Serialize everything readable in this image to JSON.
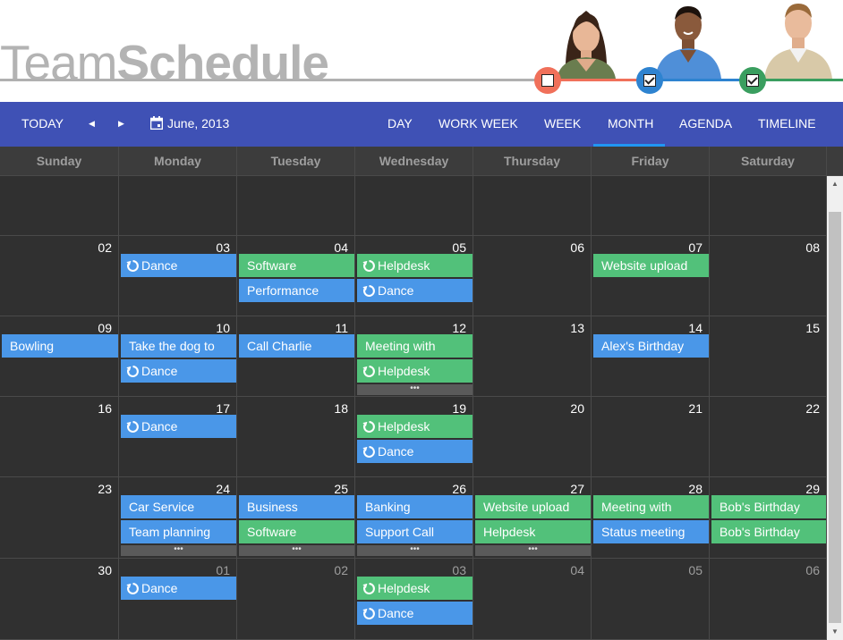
{
  "app": {
    "title_light": "Team",
    "title_bold": "Schedule"
  },
  "employees": [
    {
      "color": "#f0705a",
      "checked": false,
      "photo": "woman-portrait"
    },
    {
      "color": "#2e83d0",
      "checked": true,
      "photo": "man-portrait"
    },
    {
      "color": "#3a9e5f",
      "checked": true,
      "photo": "man-portrait"
    }
  ],
  "toolbar": {
    "today": "TODAY",
    "prev_icon": "caret-left-icon",
    "next_icon": "caret-right-icon",
    "calendar_icon": "calendar-icon",
    "date_label": "June, 2013",
    "views": [
      "DAY",
      "WORK WEEK",
      "WEEK",
      "MONTH",
      "AGENDA",
      "TIMELINE"
    ],
    "active_view": "MONTH"
  },
  "colors": {
    "toolbar": "#3f51b5",
    "active_underline": "#2196f3",
    "event_blue": "#4a97e8",
    "event_green": "#52c17a",
    "grid_bg": "#303030"
  },
  "day_headers": [
    "Sunday",
    "Monday",
    "Tuesday",
    "Wednesday",
    "Thursday",
    "Friday",
    "Saturday"
  ],
  "weeks": [
    {
      "days": [
        {
          "date": "",
          "events": []
        },
        {
          "date": "",
          "events": []
        },
        {
          "date": "",
          "events": []
        },
        {
          "date": "",
          "events": []
        },
        {
          "date": "",
          "events": []
        },
        {
          "date": "",
          "events": []
        },
        {
          "date": "",
          "events": []
        }
      ]
    },
    {
      "days": [
        {
          "date": "02",
          "events": []
        },
        {
          "date": "03",
          "events": [
            {
              "text": "Dance",
              "color": "blue",
              "recurring": true
            }
          ]
        },
        {
          "date": "04",
          "events": [
            {
              "text": "Software",
              "color": "green",
              "recurring": false
            },
            {
              "text": "Performance",
              "color": "blue",
              "recurring": false
            }
          ]
        },
        {
          "date": "05",
          "events": [
            {
              "text": "Helpdesk",
              "color": "green",
              "recurring": true
            },
            {
              "text": "Dance",
              "color": "blue",
              "recurring": true
            }
          ]
        },
        {
          "date": "06",
          "events": []
        },
        {
          "date": "07",
          "events": [
            {
              "text": "Website upload",
              "color": "green",
              "recurring": false
            }
          ]
        },
        {
          "date": "08",
          "events": []
        }
      ]
    },
    {
      "days": [
        {
          "date": "09",
          "events": [
            {
              "text": "Bowling",
              "color": "blue",
              "recurring": false
            }
          ]
        },
        {
          "date": "10",
          "events": [
            {
              "text": "Take the dog to",
              "color": "blue",
              "recurring": false
            },
            {
              "text": "Dance",
              "color": "blue",
              "recurring": true
            }
          ]
        },
        {
          "date": "11",
          "events": [
            {
              "text": "Call Charlie",
              "color": "blue",
              "recurring": false
            }
          ]
        },
        {
          "date": "12",
          "events": [
            {
              "text": "Meeting with",
              "color": "green",
              "recurring": false
            },
            {
              "text": "Helpdesk",
              "color": "green",
              "recurring": true
            }
          ],
          "more": "•••"
        },
        {
          "date": "13",
          "events": []
        },
        {
          "date": "14",
          "events": [
            {
              "text": "Alex's Birthday",
              "color": "blue",
              "recurring": false
            }
          ]
        },
        {
          "date": "15",
          "events": []
        }
      ]
    },
    {
      "days": [
        {
          "date": "16",
          "events": []
        },
        {
          "date": "17",
          "events": [
            {
              "text": "Dance",
              "color": "blue",
              "recurring": true
            }
          ]
        },
        {
          "date": "18",
          "events": []
        },
        {
          "date": "19",
          "events": [
            {
              "text": "Helpdesk",
              "color": "green",
              "recurring": true
            },
            {
              "text": "Dance",
              "color": "blue",
              "recurring": true
            }
          ]
        },
        {
          "date": "20",
          "events": []
        },
        {
          "date": "21",
          "events": []
        },
        {
          "date": "22",
          "events": []
        }
      ]
    },
    {
      "days": [
        {
          "date": "23",
          "events": []
        },
        {
          "date": "24",
          "events": [
            {
              "text": "Car Service",
              "color": "blue",
              "recurring": false
            },
            {
              "text": "Team planning",
              "color": "blue",
              "recurring": false
            }
          ],
          "more": "•••"
        },
        {
          "date": "25",
          "events": [
            {
              "text": "Business",
              "color": "blue",
              "recurring": false
            },
            {
              "text": "Software",
              "color": "green",
              "recurring": false
            }
          ],
          "more": "•••"
        },
        {
          "date": "26",
          "events": [
            {
              "text": "Banking",
              "color": "blue",
              "recurring": false
            },
            {
              "text": "Support Call",
              "color": "blue",
              "recurring": false
            }
          ],
          "more": "•••"
        },
        {
          "date": "27",
          "events": [
            {
              "text": "Website upload",
              "color": "green",
              "recurring": false
            },
            {
              "text": "Helpdesk",
              "color": "green",
              "recurring": false
            }
          ],
          "more": "•••"
        },
        {
          "date": "28",
          "events": [
            {
              "text": "Meeting with",
              "color": "green",
              "recurring": false
            },
            {
              "text": "Status meeting",
              "color": "blue",
              "recurring": false
            }
          ]
        },
        {
          "date": "29",
          "events": [
            {
              "text": "Bob's Birthday",
              "color": "green",
              "recurring": false
            },
            {
              "text": "Bob's Birthday",
              "color": "green",
              "recurring": false
            }
          ]
        }
      ]
    },
    {
      "days": [
        {
          "date": "30",
          "events": []
        },
        {
          "date": "01",
          "other": true,
          "events": [
            {
              "text": "Dance",
              "color": "blue",
              "recurring": true
            }
          ]
        },
        {
          "date": "02",
          "other": true,
          "events": []
        },
        {
          "date": "03",
          "other": true,
          "events": [
            {
              "text": "Helpdesk",
              "color": "green",
              "recurring": true
            },
            {
              "text": "Dance",
              "color": "blue",
              "recurring": true
            }
          ]
        },
        {
          "date": "04",
          "other": true,
          "events": []
        },
        {
          "date": "05",
          "other": true,
          "events": []
        },
        {
          "date": "06",
          "other": true,
          "events": []
        }
      ]
    }
  ]
}
